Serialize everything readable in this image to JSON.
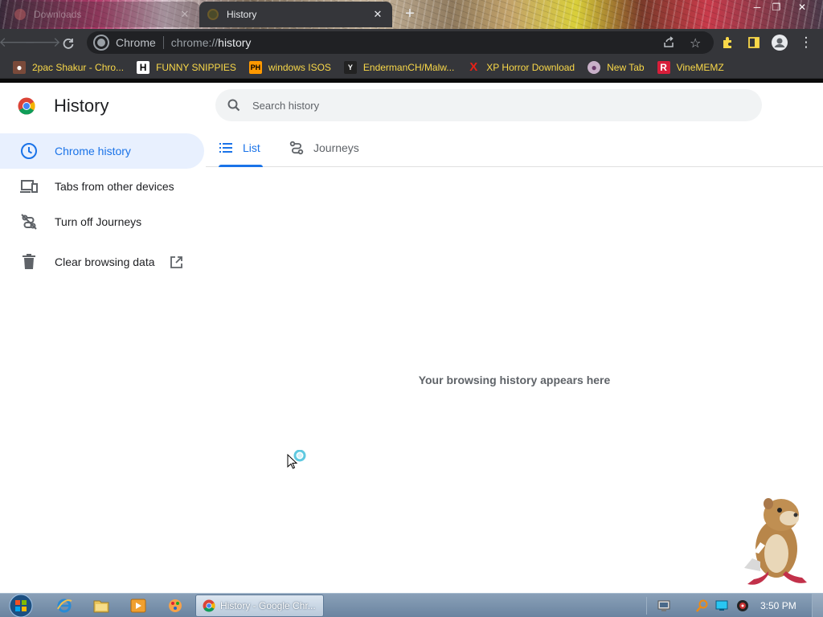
{
  "browser": {
    "tabs": [
      {
        "title": "Downloads",
        "active": false
      },
      {
        "title": "History",
        "active": true
      }
    ],
    "omnibox": {
      "site_label": "Chrome",
      "scheme": "chrome://",
      "host": "history"
    },
    "bookmarks": [
      {
        "label": "2pac Shakur - Chro...",
        "icon": "rapper-avatar-icon"
      },
      {
        "label": "FUNNY SNIPPIES",
        "icon": "h-letter-icon"
      },
      {
        "label": "windows ISOS",
        "icon": "ph-logo-icon"
      },
      {
        "label": "EndermanCH/Malw...",
        "icon": "yp-logo-icon"
      },
      {
        "label": "XP Horror Download",
        "icon": "red-x-icon"
      },
      {
        "label": "New Tab",
        "icon": "globe-avatar-icon"
      },
      {
        "label": "VineMEMZ",
        "icon": "red-r-icon"
      }
    ]
  },
  "page": {
    "title": "History",
    "search_placeholder": "Search history",
    "sidebar": [
      {
        "label": "Chrome history",
        "icon": "clock-icon",
        "active": true
      },
      {
        "label": "Tabs from other devices",
        "icon": "devices-icon",
        "active": false
      },
      {
        "label": "Turn off Journeys",
        "icon": "journeys-off-icon",
        "active": false
      },
      {
        "label": "Clear browsing data",
        "icon": "trash-icon",
        "active": false
      }
    ],
    "tabs": [
      {
        "label": "List",
        "active": true
      },
      {
        "label": "Journeys",
        "active": false
      }
    ],
    "empty_message": "Your browsing history appears here"
  },
  "taskbar": {
    "active_task": "History - Google Chr...",
    "clock": "3:50 PM"
  },
  "colors": {
    "accent": "#1a73e8",
    "active_bg": "#e8f0fe",
    "toolbar": "#35363a",
    "bookmark_text": "#f9d849"
  }
}
